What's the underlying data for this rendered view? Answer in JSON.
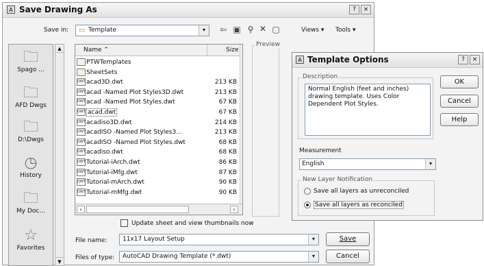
{
  "save_dialog": {
    "title": "Save Drawing As",
    "help_btn": "?",
    "close_btn": "×",
    "save_in_label": "Save in:",
    "save_in_value": "Template",
    "views_label": "Views",
    "tools_label": "Tools",
    "preview_label": "Preview",
    "places": [
      {
        "label": "Spago ...",
        "icon": "folder-icon"
      },
      {
        "label": "AFD Dwgs",
        "icon": "folder-icon"
      },
      {
        "label": "D:\\Dwgs",
        "icon": "folder-icon"
      },
      {
        "label": "History",
        "icon": "history-icon"
      },
      {
        "label": "My Doc...",
        "icon": "my-documents-icon"
      },
      {
        "label": "Favorites",
        "icon": "favorites-star-icon"
      }
    ],
    "columns": {
      "name": "Name",
      "size": "Size"
    },
    "files": [
      {
        "name": "PTWTemplates",
        "size": "",
        "type": "folder"
      },
      {
        "name": "SheetSets",
        "size": "",
        "type": "folder"
      },
      {
        "name": "acad3D.dwt",
        "size": "213 KB",
        "type": "dwt"
      },
      {
        "name": "acad -Named Plot Styles3D.dwt",
        "size": "213 KB",
        "type": "dwt"
      },
      {
        "name": "acad -Named Plot Styles.dwt",
        "size": "67 KB",
        "type": "dwt"
      },
      {
        "name": "acad.dwt",
        "size": "67 KB",
        "type": "dwt",
        "selected": true
      },
      {
        "name": "acadiso3D.dwt",
        "size": "214 KB",
        "type": "dwt"
      },
      {
        "name": "acadISO -Named Plot Styles3...",
        "size": "213 KB",
        "type": "dwt"
      },
      {
        "name": "acadISO -Named Plot Styles.dwt",
        "size": "68 KB",
        "type": "dwt"
      },
      {
        "name": "acadiso.dwt",
        "size": "68 KB",
        "type": "dwt"
      },
      {
        "name": "Tutorial-iArch.dwt",
        "size": "86 KB",
        "type": "dwt"
      },
      {
        "name": "Tutorial-iMfg.dwt",
        "size": "87 KB",
        "type": "dwt"
      },
      {
        "name": "Tutorial-mArch.dwt",
        "size": "90 KB",
        "type": "dwt"
      },
      {
        "name": "Tutorial-mMfg.dwt",
        "size": "90 KB",
        "type": "dwt"
      }
    ],
    "thumbnail_checkbox": "Update sheet and view thumbnails now",
    "file_name_label": "File name:",
    "file_name_value": "11x17 Layout Setup",
    "file_type_label": "Files of type:",
    "file_type_value": "AutoCAD Drawing Template (*.dwt)",
    "save_button": "Save",
    "cancel_button": "Cancel"
  },
  "template_options": {
    "title": "Template Options",
    "help_btn": "?",
    "close_btn": "×",
    "description_label": "Description",
    "description_text": "Normal English (feet and inches) drawing template. Uses Color Dependent Plot Styles.",
    "measurement_label": "Measurement",
    "measurement_value": "English",
    "notification_label": "New Layer Notification",
    "radio_unreconciled": "Save all layers as unreconciled",
    "radio_reconciled": "Save all layers as reconciled",
    "ok_button": "OK",
    "cancel_button": "Cancel",
    "help_button": "Help"
  }
}
